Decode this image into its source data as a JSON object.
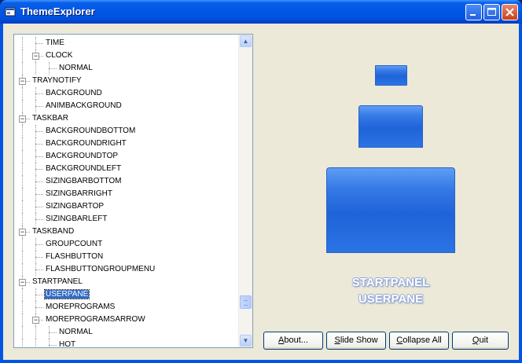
{
  "window": {
    "title": "ThemeExplorer"
  },
  "tree": {
    "nodes": [
      {
        "label": "TIME",
        "depth": 2,
        "expander": "",
        "selected": false
      },
      {
        "label": "CLOCK",
        "depth": 2,
        "expander": "−",
        "selected": false
      },
      {
        "label": "NORMAL",
        "depth": 3,
        "expander": "",
        "selected": false
      },
      {
        "label": "TRAYNOTIFY",
        "depth": 1,
        "expander": "−",
        "selected": false
      },
      {
        "label": "BACKGROUND",
        "depth": 2,
        "expander": "",
        "selected": false
      },
      {
        "label": "ANIMBACKGROUND",
        "depth": 2,
        "expander": "",
        "selected": false
      },
      {
        "label": "TASKBAR",
        "depth": 1,
        "expander": "−",
        "selected": false
      },
      {
        "label": "BACKGROUNDBOTTOM",
        "depth": 2,
        "expander": "",
        "selected": false
      },
      {
        "label": "BACKGROUNDRIGHT",
        "depth": 2,
        "expander": "",
        "selected": false
      },
      {
        "label": "BACKGROUNDTOP",
        "depth": 2,
        "expander": "",
        "selected": false
      },
      {
        "label": "BACKGROUNDLEFT",
        "depth": 2,
        "expander": "",
        "selected": false
      },
      {
        "label": "SIZINGBARBOTTOM",
        "depth": 2,
        "expander": "",
        "selected": false
      },
      {
        "label": "SIZINGBARRIGHT",
        "depth": 2,
        "expander": "",
        "selected": false
      },
      {
        "label": "SIZINGBARTOP",
        "depth": 2,
        "expander": "",
        "selected": false
      },
      {
        "label": "SIZINGBARLEFT",
        "depth": 2,
        "expander": "",
        "selected": false
      },
      {
        "label": "TASKBAND",
        "depth": 1,
        "expander": "−",
        "selected": false
      },
      {
        "label": "GROUPCOUNT",
        "depth": 2,
        "expander": "",
        "selected": false
      },
      {
        "label": "FLASHBUTTON",
        "depth": 2,
        "expander": "",
        "selected": false
      },
      {
        "label": "FLASHBUTTONGROUPMENU",
        "depth": 2,
        "expander": "",
        "selected": false
      },
      {
        "label": "STARTPANEL",
        "depth": 1,
        "expander": "−",
        "selected": false
      },
      {
        "label": "USERPANE",
        "depth": 2,
        "expander": "",
        "selected": true
      },
      {
        "label": "MOREPROGRAMS",
        "depth": 2,
        "expander": "",
        "selected": false
      },
      {
        "label": "MOREPROGRAMSARROW",
        "depth": 2,
        "expander": "−",
        "selected": false
      },
      {
        "label": "NORMAL",
        "depth": 3,
        "expander": "",
        "selected": false
      },
      {
        "label": "HOT",
        "depth": 3,
        "expander": "",
        "selected": false
      }
    ],
    "scroll_position": 0.82
  },
  "preview": {
    "caption_line1": "STARTPANEL",
    "caption_line2": "USERPANE"
  },
  "buttons": {
    "about": {
      "hot": "A",
      "rest": "bout..."
    },
    "slideshow": {
      "hot": "S",
      "rest": "lide Show"
    },
    "collapse": {
      "hot": "C",
      "rest": "ollapse All"
    },
    "quit": {
      "hot": "Q",
      "rest": "uit"
    }
  },
  "icons": {
    "scroll_up": "▲",
    "scroll_down": "▼"
  },
  "colors": {
    "titlebar": "#0058e6",
    "selection": "#316ac5",
    "preview_blue": "#2b74e4"
  }
}
